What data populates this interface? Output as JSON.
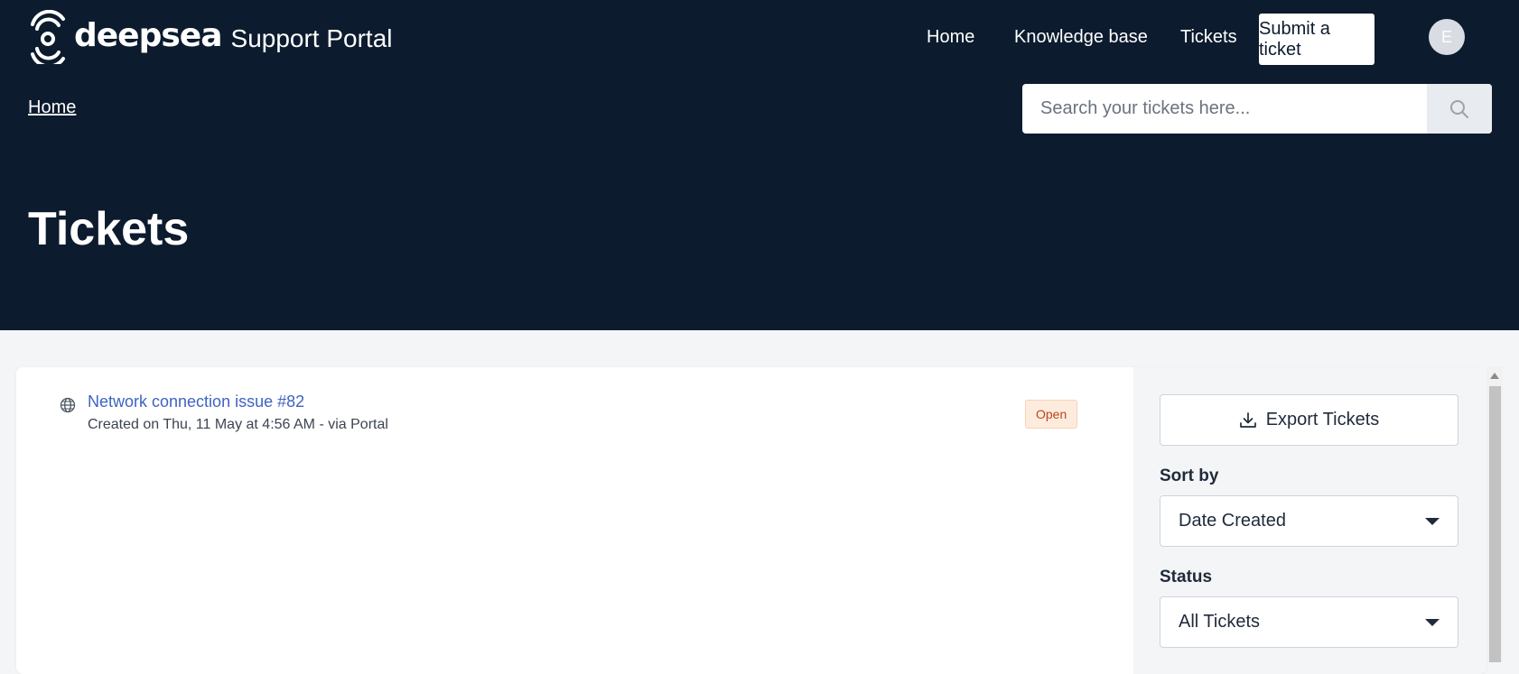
{
  "header": {
    "brand": "deepsea",
    "portal_name": "Support Portal",
    "nav": [
      {
        "label": "Home"
      },
      {
        "label": "Knowledge base"
      },
      {
        "label": "Tickets"
      }
    ],
    "submit_button": "Submit a ticket",
    "avatar_initial": "E"
  },
  "breadcrumb": {
    "home": "Home"
  },
  "search": {
    "placeholder": "Search your tickets here..."
  },
  "page": {
    "title": "Tickets"
  },
  "tickets": [
    {
      "title": "Network connection issue #82",
      "meta": "Created on Thu, 11 May at 4:56 AM - via Portal",
      "status": "Open",
      "icon": "globe-icon"
    }
  ],
  "sidebar": {
    "export_button": "Export Tickets",
    "sort_label": "Sort by",
    "sort_value": "Date Created",
    "status_label": "Status",
    "status_value": "All Tickets"
  },
  "colors": {
    "header_bg": "#0c1b2e",
    "link": "#3e63c2",
    "badge_open_bg": "#fdecde",
    "badge_open_text": "#c0451c"
  }
}
